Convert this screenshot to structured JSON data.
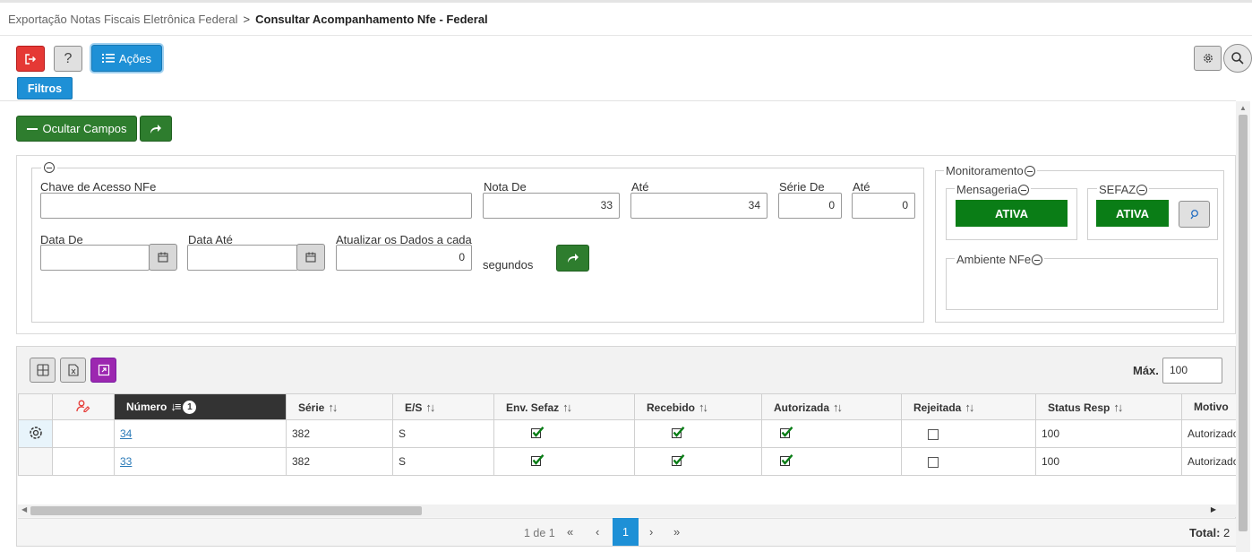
{
  "breadcrumb": {
    "parent": "Exportação Notas Fiscais Eletrônica Federal",
    "separator": ">",
    "current": "Consultar Acompanhamento Nfe - Federal"
  },
  "toolbar": {
    "help_label": "?",
    "acoes_label": "Ações",
    "filtros_label": "Filtros",
    "ocultar_label": "Ocultar Campos"
  },
  "filters": {
    "chave_label": "Chave de Acesso NFe",
    "chave_value": "",
    "nota_de_label": "Nota De",
    "nota_de_value": "33",
    "nota_ate_label": "Até",
    "nota_ate_value": "34",
    "serie_de_label": "Série De",
    "serie_de_value": "0",
    "serie_ate_label": "Até",
    "serie_ate_value": "0",
    "data_de_label": "Data De",
    "data_de_value": "",
    "data_ate_label": "Data Até",
    "data_ate_value": "",
    "atualizar_label": "Atualizar os Dados a cada",
    "atualizar_value": "0",
    "segundos_label": "segundos"
  },
  "monitoramento": {
    "title": "Monitoramento",
    "mensageria_label": "Mensageria",
    "mensageria_status": "ATIVA",
    "sefaz_label": "SEFAZ",
    "sefaz_status": "ATIVA",
    "ambiente_label": "Ambiente NFe",
    "status_color": "#0a7d16"
  },
  "grid": {
    "max_label": "Máx.",
    "max_value": "100",
    "columns": [
      "Número",
      "Série",
      "E/S",
      "Env. Sefaz",
      "Recebido",
      "Autorizada",
      "Rejeitada",
      "Status Resp",
      "Motivo"
    ],
    "sort_badge": "1",
    "rows": [
      {
        "numero": "34",
        "serie": "382",
        "es": "S",
        "env_sefaz": true,
        "recebido": true,
        "autorizada": true,
        "rejeitada": false,
        "status_resp": "100",
        "motivo": "Autorizado"
      },
      {
        "numero": "33",
        "serie": "382",
        "es": "S",
        "env_sefaz": true,
        "recebido": true,
        "autorizada": true,
        "rejeitada": false,
        "status_resp": "100",
        "motivo": "Autorizado"
      }
    ]
  },
  "pagination": {
    "info": "1 de 1",
    "first": "«",
    "prev": "‹",
    "current": "1",
    "next": "›",
    "last": "»",
    "total_label": "Total:",
    "total_value": "2"
  },
  "colors": {
    "accent_blue": "#1e90d6",
    "green": "#2e7d2e",
    "exit_red": "#e53935",
    "expand_purple": "#9c27b0"
  }
}
